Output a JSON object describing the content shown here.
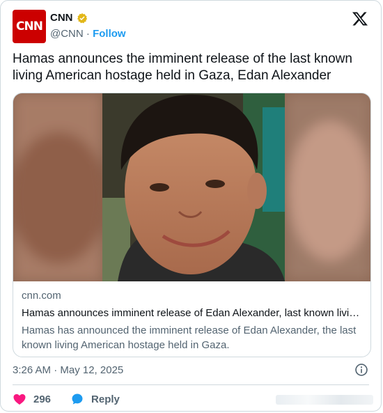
{
  "account": {
    "avatar_text": "CNN",
    "name": "CNN",
    "handle": "@CNN",
    "separator": "·",
    "follow_label": "Follow"
  },
  "tweet": {
    "text": "Hamas announces the imminent release of the last known living American hostage held in Gaza, Edan Alexander"
  },
  "link_card": {
    "domain": "cnn.com",
    "title": "Hamas announces imminent release of Edan Alexander, last known livi…",
    "description": "Hamas has announced the imminent release of Edan Alexander, the last known living American hostage held in Gaza."
  },
  "meta": {
    "timestamp": "3:26 AM · May 12, 2025"
  },
  "actions": {
    "like_count": "296",
    "reply_label": "Reply"
  },
  "colors": {
    "brand_red": "#cc0000",
    "link_blue": "#1d9bf0",
    "like_pink": "#f91880",
    "verified_gold": "#e2b719"
  },
  "icons": [
    "verified-badge-icon",
    "x-logo-icon",
    "info-icon",
    "heart-icon",
    "reply-bubble-icon"
  ]
}
